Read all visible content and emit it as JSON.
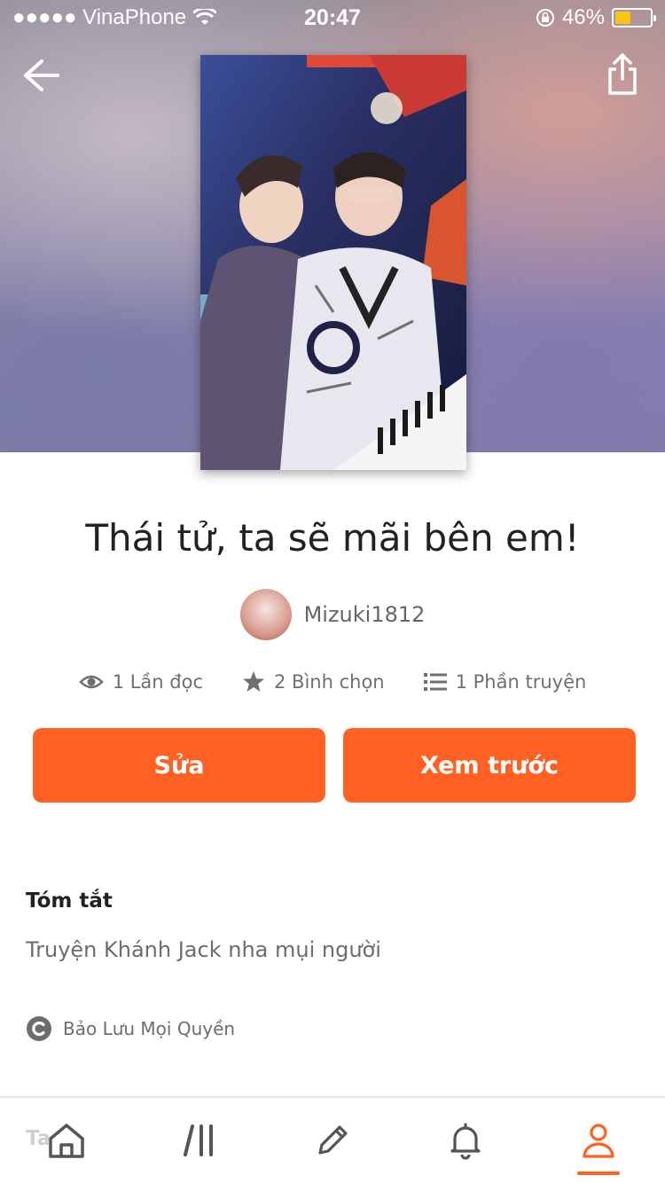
{
  "status_bar": {
    "carrier": "●●●●● VinaPhone",
    "time": "20:47",
    "battery_percent": "46%",
    "battery_level": 0.46
  },
  "story": {
    "title": "Thái tử, ta sẽ mãi bên em!",
    "author": "Mizuki1812"
  },
  "stats": {
    "reads": "1 Lần đọc",
    "votes": "2 Bình chọn",
    "parts": "1 Phần truyện"
  },
  "actions": {
    "edit_label": "Sửa",
    "preview_label": "Xem trước"
  },
  "summary": {
    "heading": "Tóm tắt",
    "text": "Truyện Khánh Jack nha mụi người",
    "copyright": "Bảo Lưu Mọi Quyền",
    "next_heading_peek": "Ta"
  },
  "icons": {
    "back": "arrow-left-icon",
    "share": "share-icon",
    "eye": "eye-icon",
    "star": "star-icon",
    "list": "list-icon",
    "copyright": "copyright-icon",
    "home": "home-icon",
    "library": "library-icon",
    "write": "pencil-icon",
    "notifications": "bell-icon",
    "profile": "user-icon"
  },
  "colors": {
    "accent": "#ff6122",
    "tab_inactive": "#555555"
  }
}
